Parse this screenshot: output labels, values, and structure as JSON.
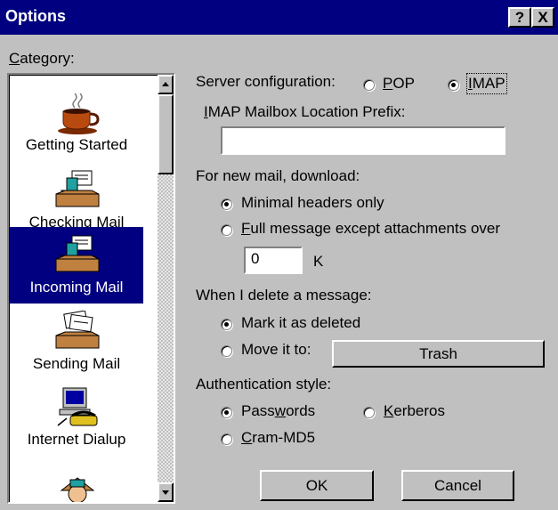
{
  "window": {
    "title": "Options",
    "help_button": "?",
    "close_button": "X"
  },
  "category": {
    "label_prefix": "",
    "label_accel": "C",
    "label_rest": "ategory:",
    "items": [
      {
        "label": "Getting Started",
        "icon": "coffee-cup-icon"
      },
      {
        "label": "Checking Mail",
        "icon": "inbox-tray-icon"
      },
      {
        "label": "Incoming Mail",
        "icon": "inbox-tray-icon",
        "selected": true
      },
      {
        "label": "Sending Mail",
        "icon": "outbox-tray-icon"
      },
      {
        "label": "Internet Dialup",
        "icon": "computer-phone-icon"
      }
    ]
  },
  "server": {
    "label": "Server configuration:",
    "pop_accel": "P",
    "pop_rest": "OP",
    "imap_accel": "I",
    "imap_rest": "MAP",
    "selected": "IMAP"
  },
  "imap_prefix": {
    "label_accel": "I",
    "label_rest": "MAP Mailbox Location Prefix:",
    "value": ""
  },
  "download": {
    "label": "For new mail, download:",
    "minimal": "Minimal headers only",
    "full_accel": "F",
    "full_rest": "ull message except attachments over",
    "size_value": "0",
    "size_unit": "K",
    "selected": "minimal"
  },
  "delete": {
    "label": "When I delete a message:",
    "mark": "Mark it as deleted",
    "move": "Move it to:",
    "folder": "Trash",
    "selected": "mark"
  },
  "auth": {
    "label": "Authentication style:",
    "pass_pre": "Pass",
    "pass_accel": "w",
    "pass_rest": "ords",
    "kerb_accel": "K",
    "kerb_rest": "erberos",
    "cram_accel": "C",
    "cram_rest": "ram-MD5",
    "selected": "passwords"
  },
  "buttons": {
    "ok": "OK",
    "cancel": "Cancel"
  }
}
